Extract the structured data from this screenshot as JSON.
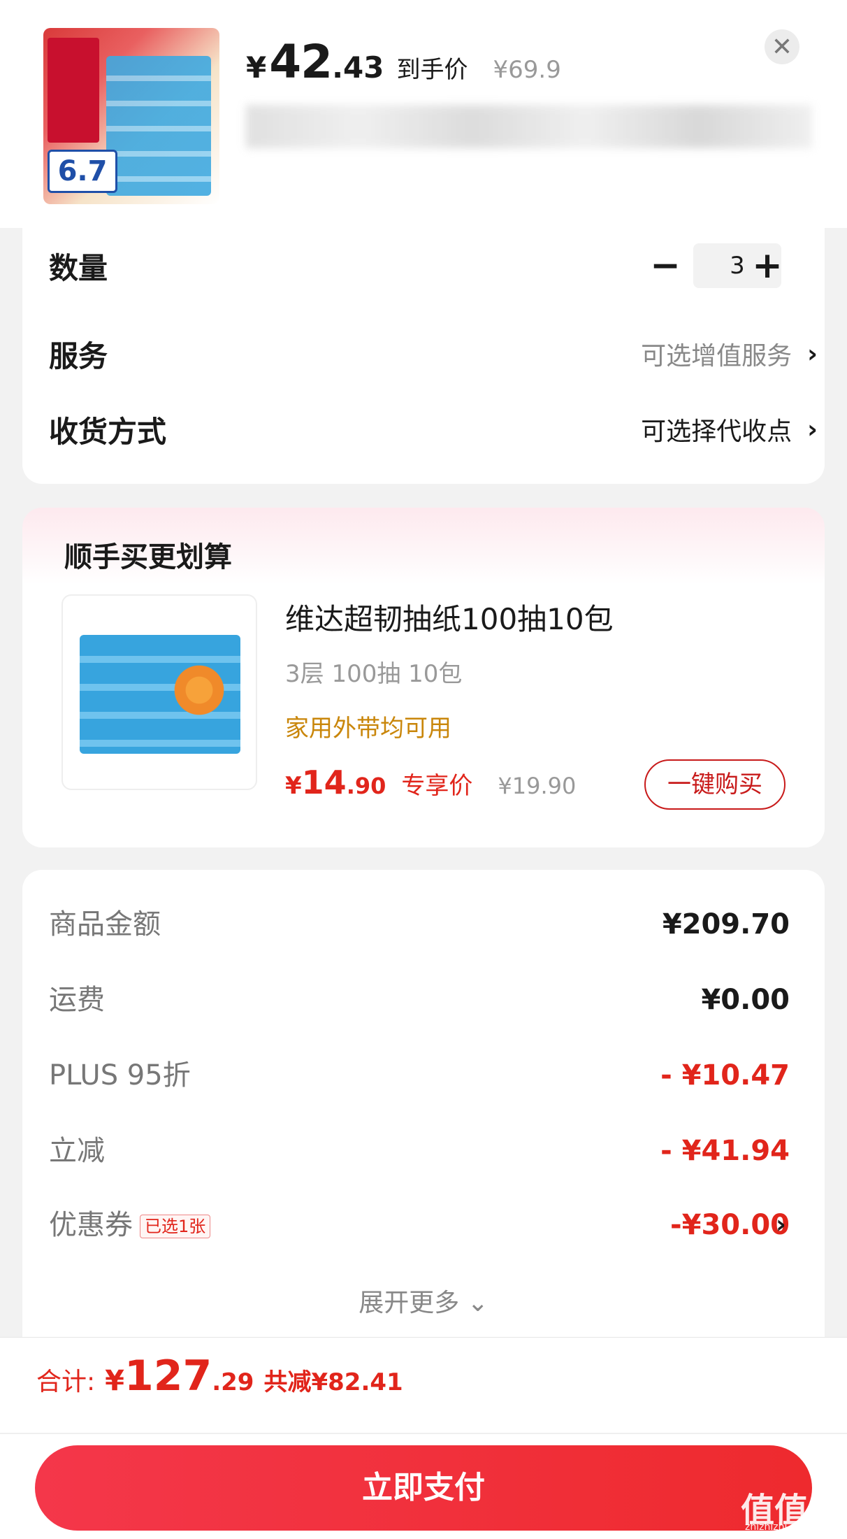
{
  "header": {
    "price_symbol": "¥",
    "price_int": "42",
    "price_dec": ".43",
    "price_tag": "到手价",
    "original_price": "¥69.9",
    "close_icon": "close-icon"
  },
  "options": {
    "quantity_label": "数量",
    "quantity_value": "3",
    "minus_label": "−",
    "plus_label": "+",
    "service_label": "服务",
    "service_value": "可选增值服务",
    "delivery_label": "收货方式",
    "delivery_value": "可选择代收点",
    "chevron": "›"
  },
  "addon": {
    "title": "顺手买更划算",
    "name": "维达超韧抽纸100抽10包",
    "spec": "3层 100抽 10包",
    "note": "家用外带均可用",
    "price_symbol": "¥",
    "price_int": "14",
    "price_dec": ".90",
    "price_tag": "专享价",
    "original_price": "¥19.90",
    "buy_label": "一键购买"
  },
  "amounts": {
    "rows": [
      {
        "label": "商品金额",
        "value": "¥209.70"
      },
      {
        "label": "运费",
        "value": "¥0.00"
      },
      {
        "label": "PLUS 95折",
        "value": "- ¥10.47"
      },
      {
        "label": "立减",
        "value": "- ¥41.94"
      },
      {
        "label": "优惠券",
        "badge": "已选1张",
        "value": "-¥30.00"
      }
    ],
    "expand_label": "展开更多 ⌄"
  },
  "footer": {
    "total_label": "合计:",
    "total_symbol": "¥",
    "total_int": "127",
    "total_dec": ".29",
    "saved": "共减¥82.41",
    "pay_label": "立即支付"
  },
  "watermark": {
    "main": "值值值",
    "sub": "zhizhizhi.com"
  },
  "colors": {
    "accent_red": "#e1251b",
    "note_gold": "#c9860a",
    "pay_button": "#f4374a"
  }
}
